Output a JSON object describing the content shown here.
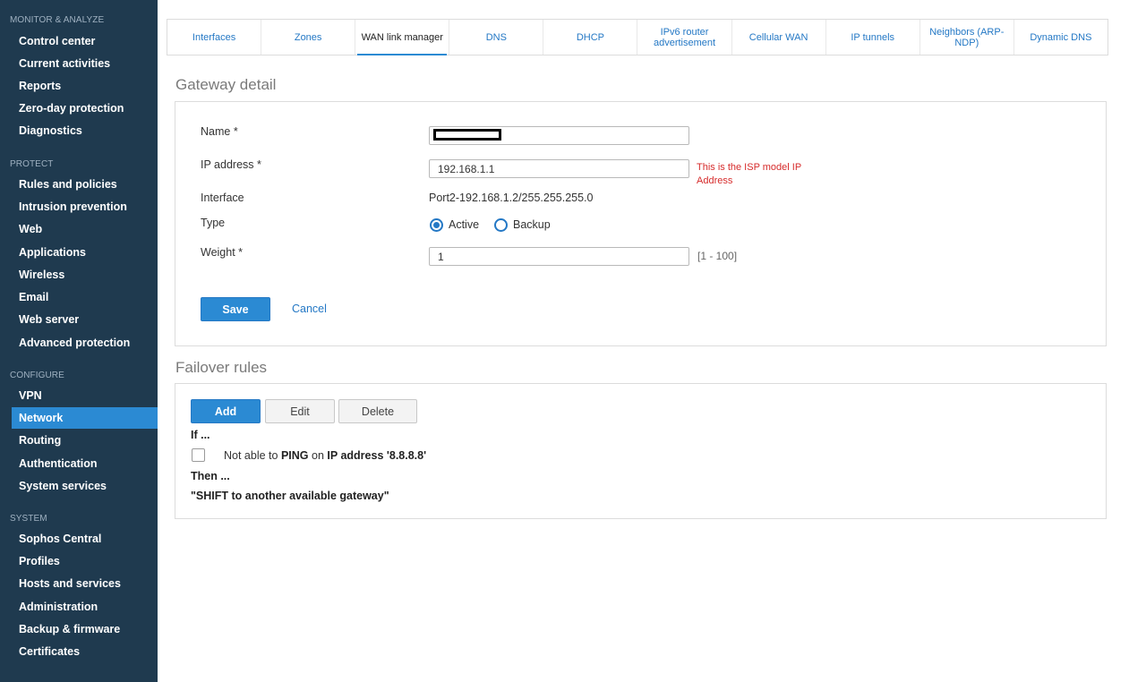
{
  "sidebar": {
    "sections": [
      {
        "title": "MONITOR & ANALYZE",
        "items": [
          "Control center",
          "Current activities",
          "Reports",
          "Zero-day protection",
          "Diagnostics"
        ]
      },
      {
        "title": "PROTECT",
        "items": [
          "Rules and policies",
          "Intrusion prevention",
          "Web",
          "Applications",
          "Wireless",
          "Email",
          "Web server",
          "Advanced protection"
        ]
      },
      {
        "title": "CONFIGURE",
        "items": [
          "VPN",
          "Network",
          "Routing",
          "Authentication",
          "System services"
        ]
      },
      {
        "title": "SYSTEM",
        "items": [
          "Sophos Central",
          "Profiles",
          "Hosts and services",
          "Administration",
          "Backup & firmware",
          "Certificates"
        ]
      }
    ],
    "active_item": "Network",
    "active_color": "#2b8ad3",
    "background": "#1f3a4f"
  },
  "tabs": [
    "Interfaces",
    "Zones",
    "WAN link manager",
    "DNS",
    "DHCP",
    "IPv6 router advertisement",
    "Cellular WAN",
    "IP tunnels",
    "Neighbors (ARP-NDP)",
    "Dynamic DNS"
  ],
  "active_tab": "WAN link manager",
  "gateway": {
    "heading": "Gateway detail",
    "name_label": "Name *",
    "name_value": "",
    "ip_label": "IP address *",
    "ip_value": "192.168.1.1",
    "ip_hint": "This is the ISP model IP Address",
    "interface_label": "Interface",
    "interface_value": "Port2-192.168.1.2/255.255.255.0",
    "type_label": "Type",
    "type_options": [
      "Active",
      "Backup"
    ],
    "type_selected": "Active",
    "weight_label": "Weight *",
    "weight_value": "1",
    "weight_range": "[1 - 100]",
    "save_label": "Save",
    "cancel_label": "Cancel"
  },
  "failover": {
    "heading": "Failover rules",
    "add_label": "Add",
    "edit_label": "Edit",
    "delete_label": "Delete",
    "if_label": "If ...",
    "rule_prefix": "Not able to",
    "rule_protocol": "PING",
    "rule_on": "on",
    "rule_target_label": "IP address",
    "rule_target_value": "'8.8.8.8'",
    "then_label": "Then ...",
    "action": "\"SHIFT to another available gateway\""
  },
  "colors": {
    "accent": "#2b8ad3",
    "link": "#2478c5",
    "hint": "#d62b2b"
  }
}
